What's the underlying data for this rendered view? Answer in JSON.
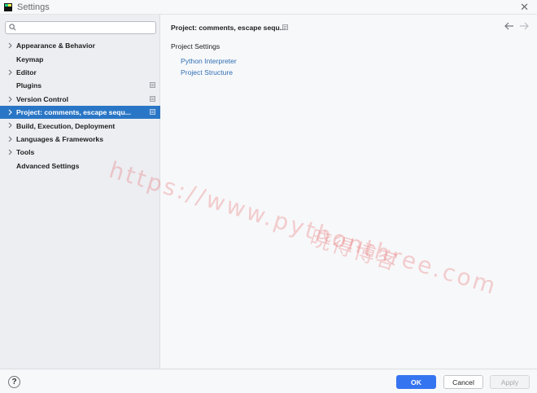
{
  "window": {
    "title": "Settings",
    "close_symbol": "✕"
  },
  "search": {
    "value": "",
    "placeholder": ""
  },
  "sidebar": {
    "items": [
      {
        "label": "Appearance & Behavior",
        "expandable": true
      },
      {
        "label": "Keymap",
        "expandable": false
      },
      {
        "label": "Editor",
        "expandable": true
      },
      {
        "label": "Plugins",
        "expandable": false
      },
      {
        "label": "Version Control",
        "expandable": true
      },
      {
        "label": "Project: comments, escape sequ...",
        "expandable": true,
        "selected": true
      },
      {
        "label": "Build, Execution, Deployment",
        "expandable": true
      },
      {
        "label": "Languages & Frameworks",
        "expandable": true
      },
      {
        "label": "Tools",
        "expandable": true
      },
      {
        "label": "Advanced Settings",
        "expandable": false
      }
    ]
  },
  "main": {
    "breadcrumb": "Project: comments, escape sequ...",
    "section_title": "Project Settings",
    "links": [
      "Python Interpreter",
      "Project Structure"
    ]
  },
  "watermark": {
    "line1": "https://www.pythonthree.com",
    "line2": "晓得博客"
  },
  "footer": {
    "help": "?",
    "ok_label": "OK",
    "cancel_label": "Cancel",
    "apply_label": "Apply"
  },
  "colors": {
    "selection": "#2a76c6",
    "primary_button": "#3574f0",
    "link": "#2f6fb3"
  },
  "icons": {
    "search": "search-icon",
    "chevron": "chevron-right-icon",
    "project_scope": "project-scope-icon",
    "back": "arrow-left-icon",
    "forward": "arrow-right-icon",
    "help": "help-icon"
  }
}
